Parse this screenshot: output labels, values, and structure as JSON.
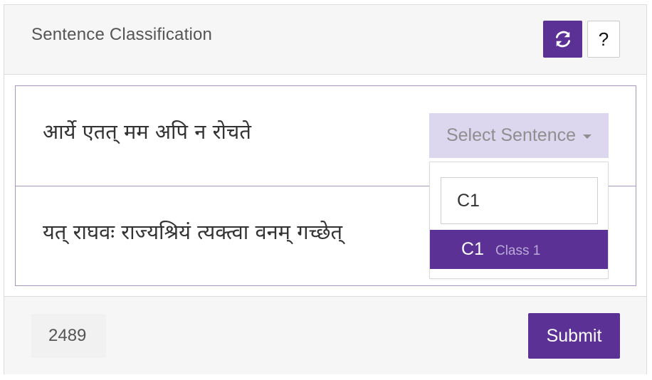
{
  "header": {
    "title": "Sentence Classification",
    "refresh_icon": "refresh-icon",
    "help_label": "?"
  },
  "sentences": [
    "आर्ये एतत् मम अपि न रोचते",
    "यत् राघवः राज्यश्रियं त्यक्त्वा वनम् गच्छेत्"
  ],
  "select": {
    "toggle_label": "Select Sentence",
    "search_value": "C1",
    "options": [
      {
        "label": "C1",
        "sublabel": "Class 1"
      }
    ]
  },
  "footer": {
    "count": "2489",
    "submit_label": "Submit"
  },
  "colors": {
    "accent": "#5c3196",
    "select_bg": "#dcd6ee",
    "header_bg": "#f6f6f6",
    "row_border": "#a597c2"
  }
}
